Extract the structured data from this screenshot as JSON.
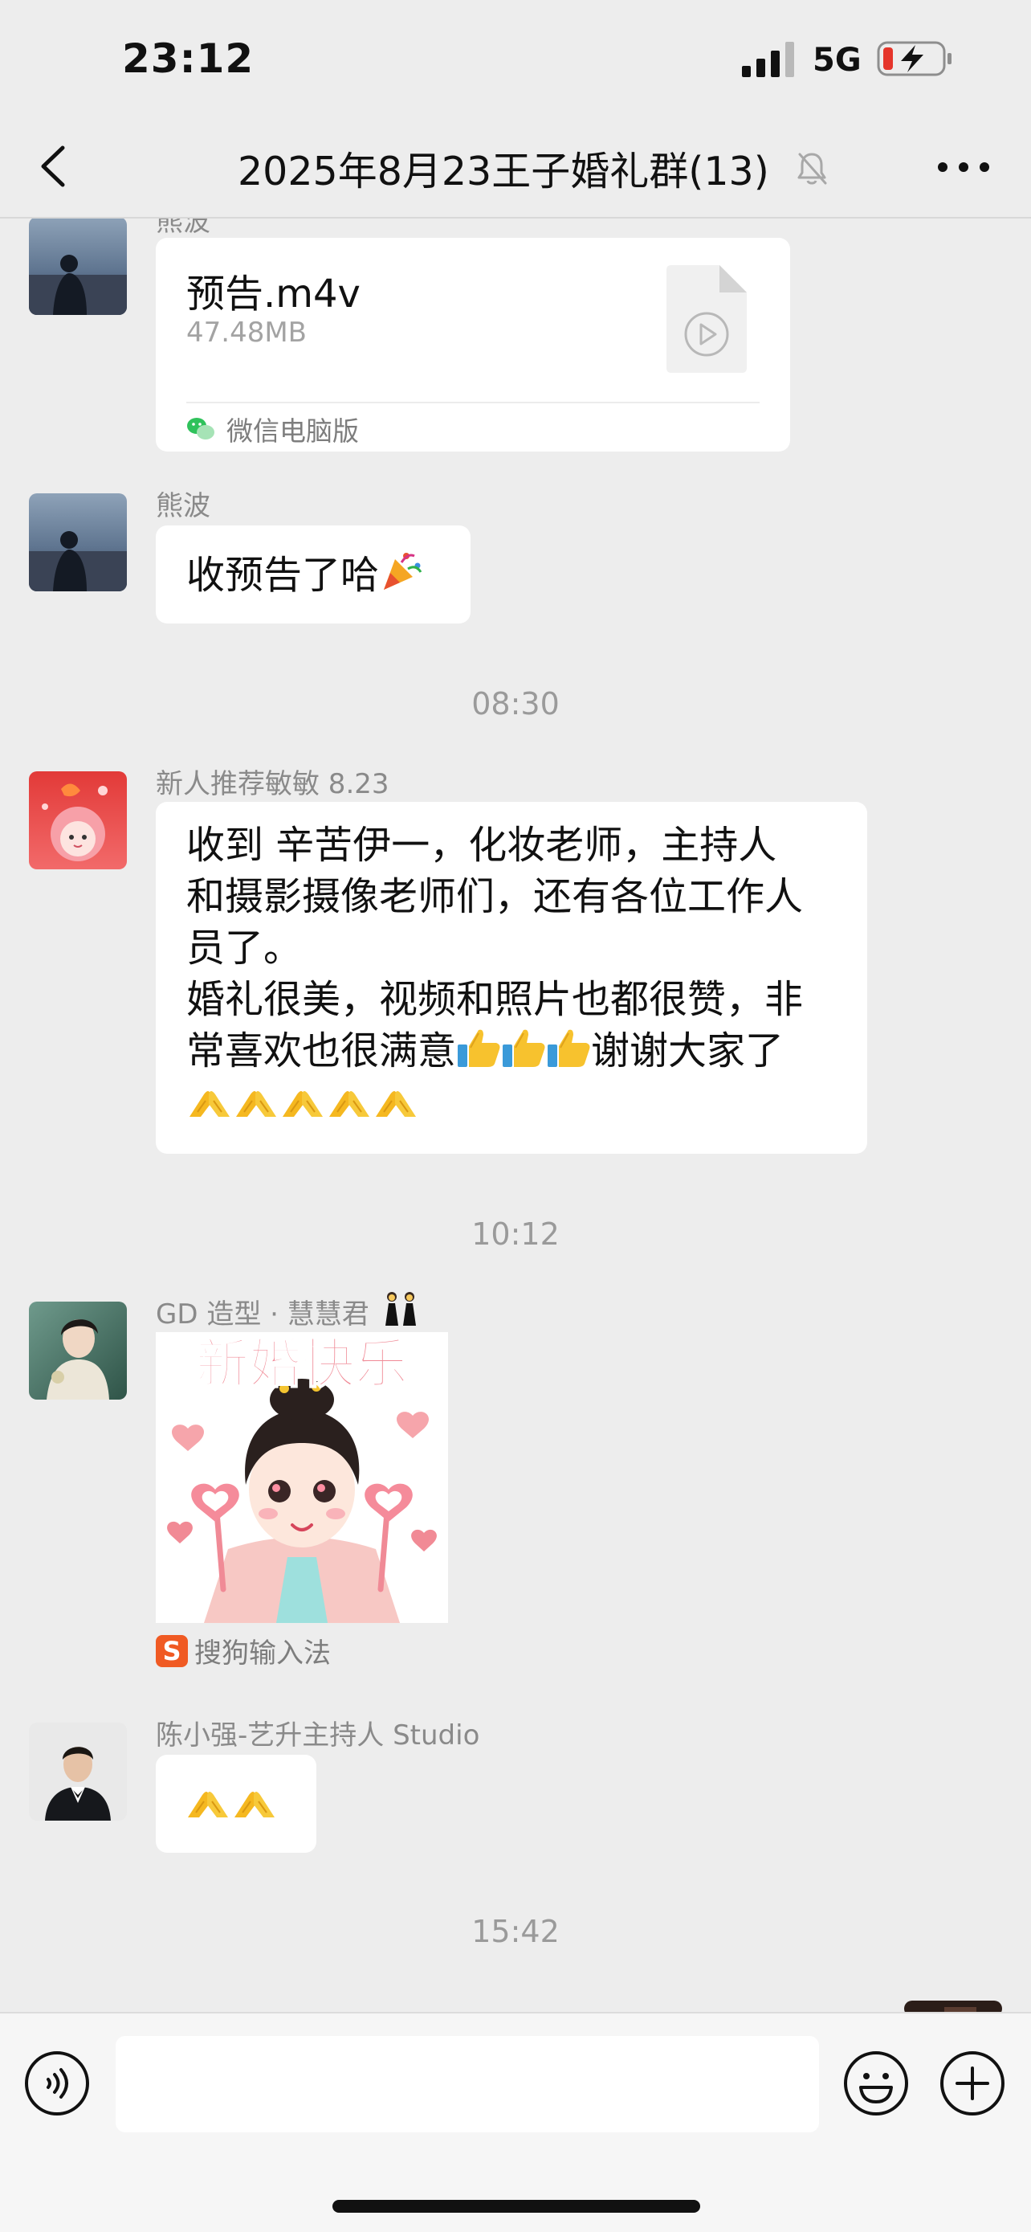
{
  "status_bar": {
    "time": "23:12",
    "network": "5G"
  },
  "nav": {
    "title": "2025年8月23王子婚礼群(13)"
  },
  "messages": {
    "m0": {
      "sender": "熊波",
      "file_name": "预告.m4v",
      "file_size": "47.48MB",
      "source": "微信电脑版"
    },
    "m1": {
      "sender": "熊波",
      "text": "收预告了哈",
      "emoji": "party-popper"
    },
    "ts1": "08:30",
    "m2": {
      "sender": "新人推荐敏敏 8.23",
      "line1": "收到 辛苦伊一，化妆老师，主持人",
      "line2": "和摄影摄像老师们，还有各位工作人",
      "line3": "员了。",
      "line4": "婚礼很美，视频和照片也都很赞，非",
      "line5": "常喜欢也很满意",
      "line5_tail": "谢谢大家了",
      "thumbs_count": 3,
      "pray_count": 5
    },
    "ts2": "10:12",
    "m3": {
      "sender": "GD 造型 · 慧慧君",
      "sticker_text": "新婚快乐",
      "sticker_source": "搜狗输入法"
    },
    "m4": {
      "sender": "陈小强-艺升主持人 Studio",
      "pray_count": 2
    },
    "ts3": "15:42"
  },
  "colors": {
    "background": "#ededed",
    "bubble": "#ffffff",
    "timestamp": "#9a9a9a",
    "sender": "#8a8a8a",
    "battery_low": "#e5352b",
    "sticker_pink": "#f08a96"
  },
  "icons": {
    "back": "chevron-left-icon",
    "mute": "bell-slash-icon",
    "more": "more-dots-icon",
    "voice": "voice-icon",
    "emoji": "smiley-icon",
    "plus": "plus-circle-icon"
  }
}
